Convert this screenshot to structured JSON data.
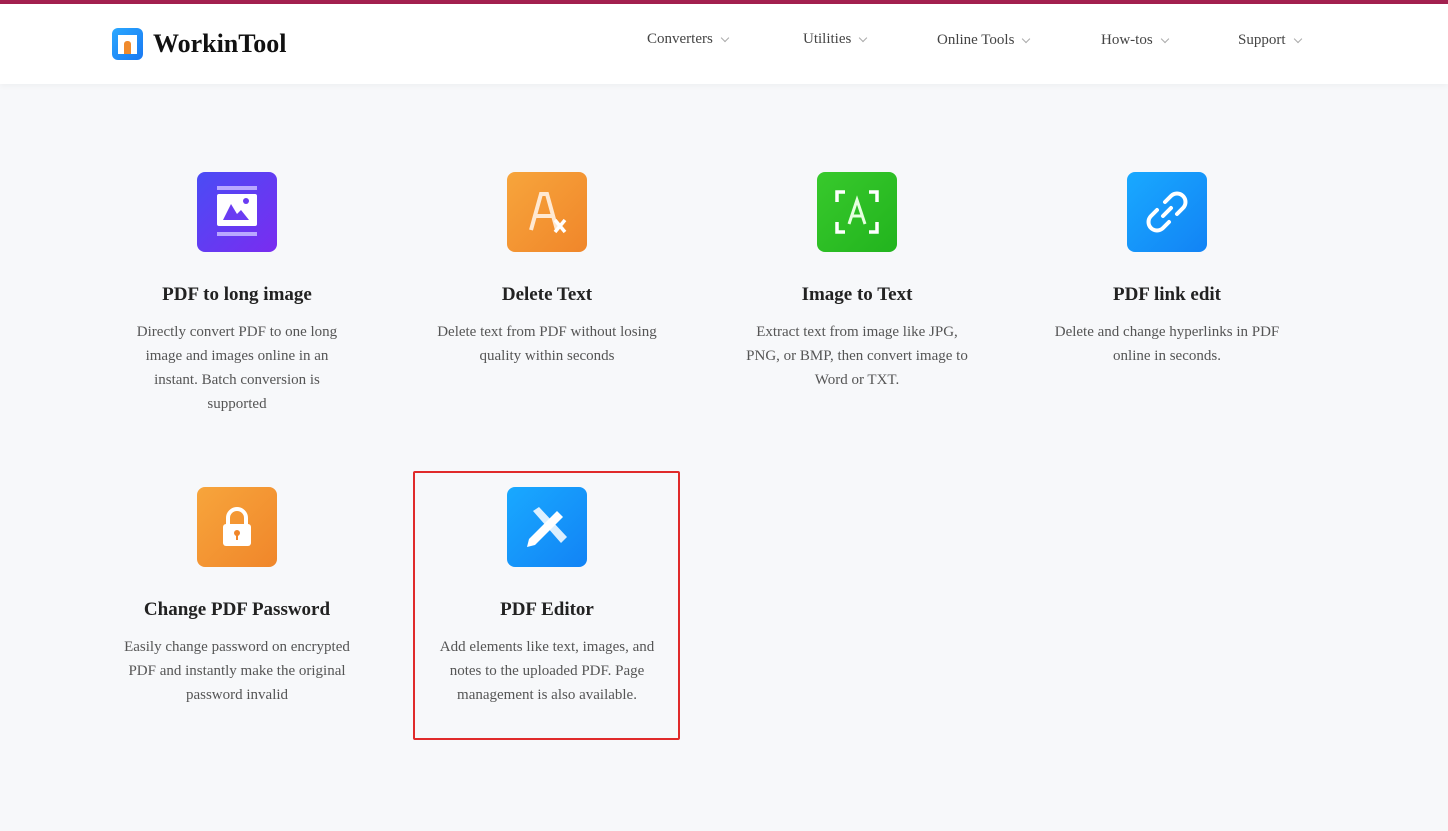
{
  "header": {
    "brand": "WorkinTool",
    "nav": [
      {
        "label": "Converters"
      },
      {
        "label": "Utilities"
      },
      {
        "label": "Online Tools"
      },
      {
        "label": "How-tos"
      },
      {
        "label": "Support"
      }
    ]
  },
  "colors": {
    "top_bar": "#a3204f",
    "highlight": "#e02a2a"
  },
  "tools": [
    {
      "title": "PDF to long image",
      "desc": "Directly convert PDF to one long image and images online in an instant. Batch conversion is supported",
      "icon": "long-image-icon"
    },
    {
      "title": "Delete Text",
      "desc": "Delete text from PDF without losing quality within seconds",
      "icon": "delete-text-icon"
    },
    {
      "title": "Image to Text",
      "desc": "Extract text from image like JPG, PNG, or BMP, then convert image to Word or TXT.",
      "icon": "ocr-icon"
    },
    {
      "title": "PDF link edit",
      "desc": "Delete and change hyperlinks in PDF online in seconds.",
      "icon": "link-icon"
    },
    {
      "title": "Change PDF Password",
      "desc": "Easily change password on encrypted PDF and instantly make the original password invalid",
      "icon": "lock-icon"
    },
    {
      "title": "PDF Editor",
      "desc": "Add elements like text, images, and notes to the uploaded PDF. Page management is also available.",
      "icon": "edit-tools-icon"
    }
  ]
}
